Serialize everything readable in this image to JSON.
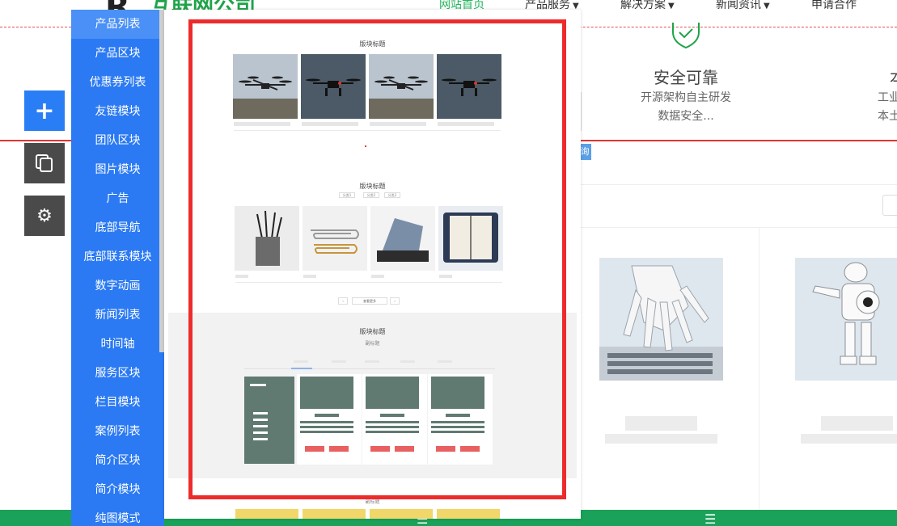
{
  "site": {
    "logo_letter": "R",
    "logo_text": "互联网公司",
    "nav": [
      {
        "label": "网站首页",
        "active": true,
        "caret": false
      },
      {
        "label": "产品服务",
        "active": false,
        "caret": true
      },
      {
        "label": "解决方案",
        "active": false,
        "caret": true
      },
      {
        "label": "新闻资讯",
        "active": false,
        "caret": true
      },
      {
        "label": "申请合作",
        "active": false,
        "caret": false
      }
    ],
    "feature": {
      "title": "安全可靠",
      "desc_line1": "开源架构自主研发",
      "desc_line2": "数据安全..."
    },
    "feature2": {
      "title": "本",
      "desc_line1": "工业",
      "desc_line2": "本土"
    },
    "tiny_tag": "询",
    "accent": "#1fa34a",
    "footer_icons": [
      "phone-icon",
      "menu-icon",
      "menu-icon"
    ]
  },
  "tools": {
    "add_glyph": "+",
    "gear_glyph": "⚙"
  },
  "modules": {
    "items": [
      "产品列表",
      "产品区块",
      "优惠券列表",
      "友链模块",
      "团队区块",
      "图片模块",
      "广告",
      "底部导航",
      "底部联系模块",
      "数字动画",
      "新闻列表",
      "时间轴",
      "服务区块",
      "栏目模块",
      "案例列表",
      "简介区块",
      "简介模块",
      "纯图模式"
    ],
    "active_index": 0,
    "color": "#2b7af3"
  },
  "preview": {
    "section1_title": "版块标题",
    "section2_title": "版块标题",
    "section2_tabs": [
      "分类1",
      "分类2",
      "分类3"
    ],
    "pager": [
      "‹",
      "查看更多",
      "›"
    ],
    "section3_title": "版块标题",
    "section3_subtitle": "副标题",
    "bottom_subtitle": "副标题",
    "frame_color": "#ee2b2b"
  }
}
